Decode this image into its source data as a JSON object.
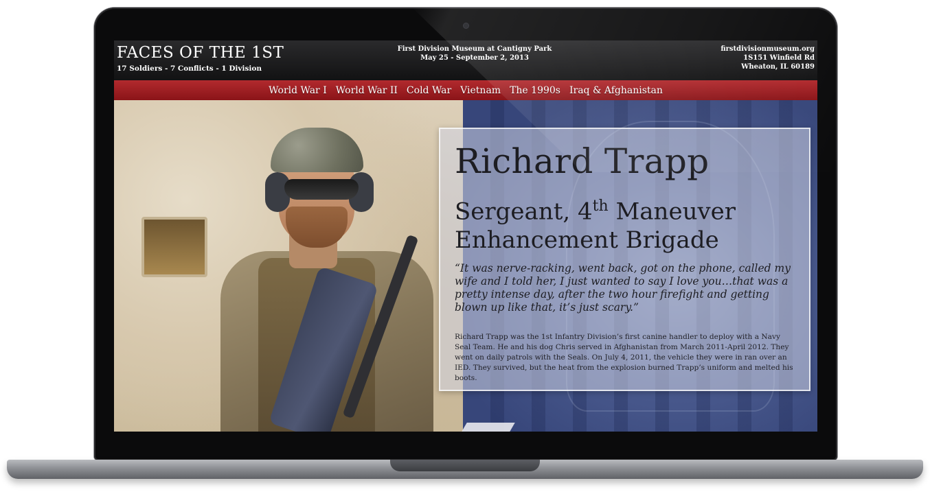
{
  "header": {
    "title": "FACES OF THE 1ST",
    "subtitle": "17 Soldiers - 7 Conflicts - 1 Division",
    "venue_line1": "First Division Museum at Cantigny Park",
    "venue_line2": "May 25 - September 2, 2013",
    "website": "firstdivisionmuseum.org",
    "address_line1": "1S151 Winfield Rd",
    "address_line2": "Wheaton, IL 60189"
  },
  "nav": {
    "items": [
      "World War I",
      "World War II",
      "Cold War",
      "Vietnam",
      "The 1990s",
      "Iraq & Afghanistan"
    ]
  },
  "profile": {
    "name": "Richard Trapp",
    "rank_part1": "Sergeant, 4",
    "rank_sup": "th",
    "rank_part2": " Maneuver Enhancement Brigade",
    "quote": "“It was nerve-racking, went back, got on the phone, called my wife and I told her, I just wanted to say I love you…that was a pretty intense day, after the two hour firefight and getting blown up like that, it’s just scary.”",
    "bio": "Richard Trapp was the 1st Infantry Division’s first canine handler to deploy with a Navy Seal Team. He and his dog Chris served in Afghanistan from March 2011-April 2012. They went on daily patrols with the Seals. On July 4, 2011, the vehicle they were in ran over an IED. They survived, but the heat from the explosion burned Trapp’s uniform and melted his boots."
  },
  "colors": {
    "nav_red": "#9a1c20",
    "header_dark": "#1a1a1b",
    "panel_text": "#1d1d22"
  }
}
